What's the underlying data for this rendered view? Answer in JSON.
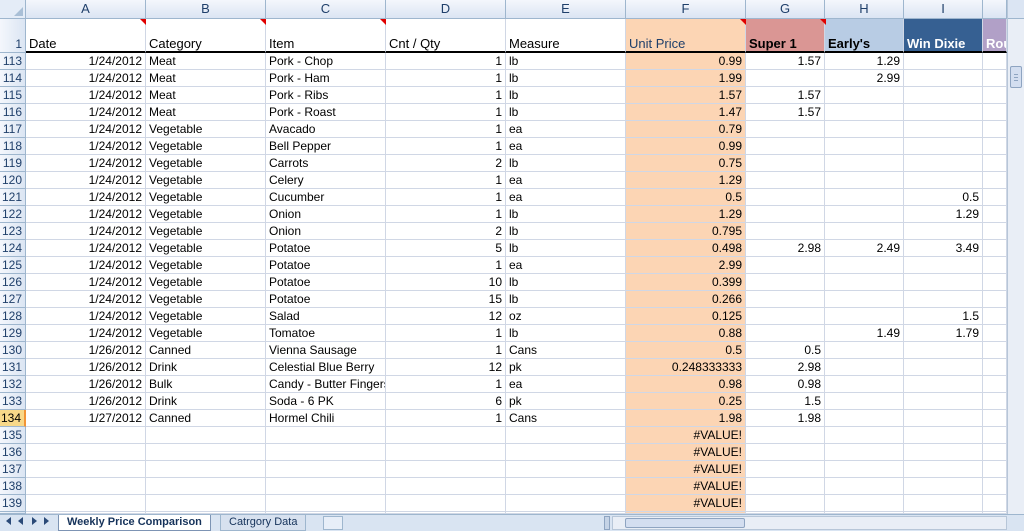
{
  "colors": {
    "unit_price_fill": "#fcd5b4",
    "super1_fill": "#da9694",
    "earlys_fill": "#b8cce4",
    "windixie_fill": "#366092",
    "rouses_fill": "#b1a0c7",
    "grid": "#d0d7e5",
    "header_fill": "#dbe5f3",
    "selected_row": "#f8d889"
  },
  "columns": [
    "A",
    "B",
    "C",
    "D",
    "E",
    "F",
    "G",
    "H",
    "I",
    ""
  ],
  "header_row_number": "1",
  "headers": [
    "Date",
    "Category",
    "Item",
    "Cnt / Qty",
    "Measure",
    "Unit Price",
    "Super 1",
    "Early's",
    "Win Dixie",
    "Rou"
  ],
  "rows": [
    {
      "n": "113",
      "a": "1/24/2012",
      "b": "Meat",
      "c": "Pork - Chop",
      "d": "1",
      "e": "lb",
      "f": "0.99",
      "g": "1.57",
      "h": "1.29",
      "i": ""
    },
    {
      "n": "114",
      "a": "1/24/2012",
      "b": "Meat",
      "c": "Pork - Ham",
      "d": "1",
      "e": "lb",
      "f": "1.99",
      "g": "",
      "h": "2.99",
      "i": ""
    },
    {
      "n": "115",
      "a": "1/24/2012",
      "b": "Meat",
      "c": "Pork - Ribs",
      "d": "1",
      "e": "lb",
      "f": "1.57",
      "g": "1.57",
      "h": "",
      "i": ""
    },
    {
      "n": "116",
      "a": "1/24/2012",
      "b": "Meat",
      "c": "Pork - Roast",
      "d": "1",
      "e": "lb",
      "f": "1.47",
      "g": "1.57",
      "h": "",
      "i": ""
    },
    {
      "n": "117",
      "a": "1/24/2012",
      "b": "Vegetable",
      "c": "Avacado",
      "d": "1",
      "e": "ea",
      "f": "0.79",
      "g": "",
      "h": "",
      "i": ""
    },
    {
      "n": "118",
      "a": "1/24/2012",
      "b": "Vegetable",
      "c": "Bell Pepper",
      "d": "1",
      "e": "ea",
      "f": "0.99",
      "g": "",
      "h": "",
      "i": ""
    },
    {
      "n": "119",
      "a": "1/24/2012",
      "b": "Vegetable",
      "c": "Carrots",
      "d": "2",
      "e": "lb",
      "f": "0.75",
      "g": "",
      "h": "",
      "i": ""
    },
    {
      "n": "120",
      "a": "1/24/2012",
      "b": "Vegetable",
      "c": "Celery",
      "d": "1",
      "e": "ea",
      "f": "1.29",
      "g": "",
      "h": "",
      "i": ""
    },
    {
      "n": "121",
      "a": "1/24/2012",
      "b": "Vegetable",
      "c": "Cucumber",
      "d": "1",
      "e": "ea",
      "f": "0.5",
      "g": "",
      "h": "",
      "i": "0.5"
    },
    {
      "n": "122",
      "a": "1/24/2012",
      "b": "Vegetable",
      "c": "Onion",
      "d": "1",
      "e": "lb",
      "f": "1.29",
      "g": "",
      "h": "",
      "i": "1.29"
    },
    {
      "n": "123",
      "a": "1/24/2012",
      "b": "Vegetable",
      "c": "Onion",
      "d": "2",
      "e": "lb",
      "f": "0.795",
      "g": "",
      "h": "",
      "i": ""
    },
    {
      "n": "124",
      "a": "1/24/2012",
      "b": "Vegetable",
      "c": "Potatoe",
      "d": "5",
      "e": "lb",
      "f": "0.498",
      "g": "2.98",
      "h": "2.49",
      "i": "3.49"
    },
    {
      "n": "125",
      "a": "1/24/2012",
      "b": "Vegetable",
      "c": "Potatoe",
      "d": "1",
      "e": "ea",
      "f": "2.99",
      "g": "",
      "h": "",
      "i": ""
    },
    {
      "n": "126",
      "a": "1/24/2012",
      "b": "Vegetable",
      "c": "Potatoe",
      "d": "10",
      "e": "lb",
      "f": "0.399",
      "g": "",
      "h": "",
      "i": ""
    },
    {
      "n": "127",
      "a": "1/24/2012",
      "b": "Vegetable",
      "c": "Potatoe",
      "d": "15",
      "e": "lb",
      "f": "0.266",
      "g": "",
      "h": "",
      "i": ""
    },
    {
      "n": "128",
      "a": "1/24/2012",
      "b": "Vegetable",
      "c": "Salad",
      "d": "12",
      "e": "oz",
      "f": "0.125",
      "g": "",
      "h": "",
      "i": "1.5"
    },
    {
      "n": "129",
      "a": "1/24/2012",
      "b": "Vegetable",
      "c": "Tomatoe",
      "d": "1",
      "e": "lb",
      "f": "0.88",
      "g": "",
      "h": "1.49",
      "i": "1.79"
    },
    {
      "n": "130",
      "a": "1/26/2012",
      "b": "Canned",
      "c": "Vienna Sausage",
      "d": "1",
      "e": "Cans",
      "f": "0.5",
      "g": "0.5",
      "h": "",
      "i": ""
    },
    {
      "n": "131",
      "a": "1/26/2012",
      "b": "Drink",
      "c": "Celestial Blue Berry",
      "d": "12",
      "e": "pk",
      "f": "0.248333333",
      "g": "2.98",
      "h": "",
      "i": ""
    },
    {
      "n": "132",
      "a": "1/26/2012",
      "b": "Bulk",
      "c": "Candy - Butter Fingers",
      "d": "1",
      "e": "ea",
      "f": "0.98",
      "g": "0.98",
      "h": "",
      "i": ""
    },
    {
      "n": "133",
      "a": "1/26/2012",
      "b": "Drink",
      "c": "Soda - 6 PK",
      "d": "6",
      "e": "pk",
      "f": "0.25",
      "g": "1.5",
      "h": "",
      "i": ""
    },
    {
      "n": "134",
      "a": "1/27/2012",
      "b": "Canned",
      "c": "Hormel Chili",
      "d": "1",
      "e": "Cans",
      "f": "1.98",
      "g": "1.98",
      "h": "",
      "i": ""
    },
    {
      "n": "135",
      "a": "",
      "b": "",
      "c": "",
      "d": "",
      "e": "",
      "f": "#VALUE!",
      "g": "",
      "h": "",
      "i": ""
    },
    {
      "n": "136",
      "a": "",
      "b": "",
      "c": "",
      "d": "",
      "e": "",
      "f": "#VALUE!",
      "g": "",
      "h": "",
      "i": ""
    },
    {
      "n": "137",
      "a": "",
      "b": "",
      "c": "",
      "d": "",
      "e": "",
      "f": "#VALUE!",
      "g": "",
      "h": "",
      "i": ""
    },
    {
      "n": "138",
      "a": "",
      "b": "",
      "c": "",
      "d": "",
      "e": "",
      "f": "#VALUE!",
      "g": "",
      "h": "",
      "i": ""
    },
    {
      "n": "139",
      "a": "",
      "b": "",
      "c": "",
      "d": "",
      "e": "",
      "f": "#VALUE!",
      "g": "",
      "h": "",
      "i": ""
    }
  ],
  "selected_row": "134",
  "sheet_tabs": [
    {
      "label": "Weekly Price Comparison",
      "active": true
    },
    {
      "label": "Catrgory Data",
      "active": false
    }
  ],
  "icons": {
    "first_sheet": "first-sheet-icon",
    "prev_sheet": "prev-sheet-icon",
    "next_sheet": "next-sheet-icon",
    "last_sheet": "last-sheet-icon",
    "new_sheet": "insert-sheet-icon"
  }
}
